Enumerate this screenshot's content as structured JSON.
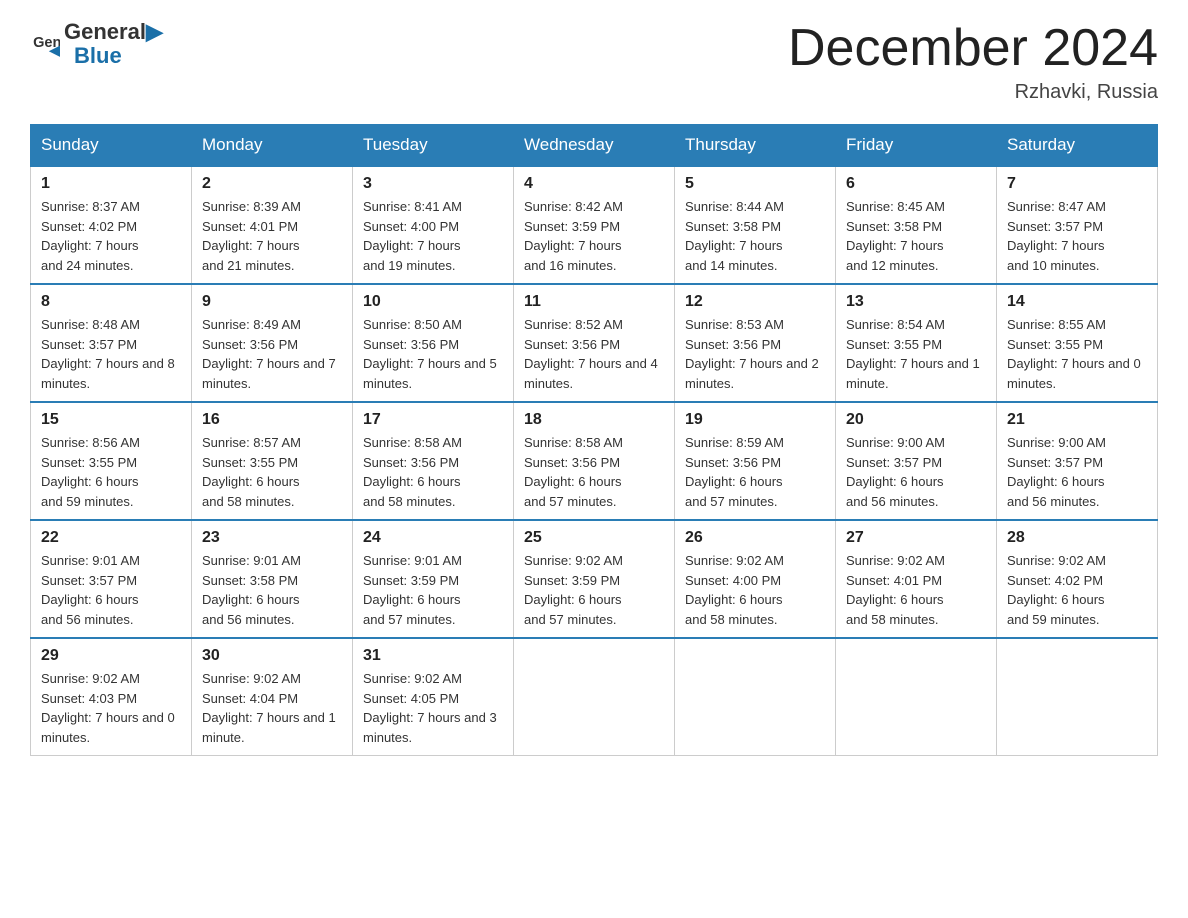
{
  "header": {
    "logo_general": "General",
    "logo_blue": "Blue",
    "month_title": "December 2024",
    "location": "Rzhavki, Russia"
  },
  "days_of_week": [
    "Sunday",
    "Monday",
    "Tuesday",
    "Wednesday",
    "Thursday",
    "Friday",
    "Saturday"
  ],
  "weeks": [
    [
      {
        "num": "1",
        "sunrise": "8:37 AM",
        "sunset": "4:02 PM",
        "daylight": "7 hours and 24 minutes."
      },
      {
        "num": "2",
        "sunrise": "8:39 AM",
        "sunset": "4:01 PM",
        "daylight": "7 hours and 21 minutes."
      },
      {
        "num": "3",
        "sunrise": "8:41 AM",
        "sunset": "4:00 PM",
        "daylight": "7 hours and 19 minutes."
      },
      {
        "num": "4",
        "sunrise": "8:42 AM",
        "sunset": "3:59 PM",
        "daylight": "7 hours and 16 minutes."
      },
      {
        "num": "5",
        "sunrise": "8:44 AM",
        "sunset": "3:58 PM",
        "daylight": "7 hours and 14 minutes."
      },
      {
        "num": "6",
        "sunrise": "8:45 AM",
        "sunset": "3:58 PM",
        "daylight": "7 hours and 12 minutes."
      },
      {
        "num": "7",
        "sunrise": "8:47 AM",
        "sunset": "3:57 PM",
        "daylight": "7 hours and 10 minutes."
      }
    ],
    [
      {
        "num": "8",
        "sunrise": "8:48 AM",
        "sunset": "3:57 PM",
        "daylight": "7 hours and 8 minutes."
      },
      {
        "num": "9",
        "sunrise": "8:49 AM",
        "sunset": "3:56 PM",
        "daylight": "7 hours and 7 minutes."
      },
      {
        "num": "10",
        "sunrise": "8:50 AM",
        "sunset": "3:56 PM",
        "daylight": "7 hours and 5 minutes."
      },
      {
        "num": "11",
        "sunrise": "8:52 AM",
        "sunset": "3:56 PM",
        "daylight": "7 hours and 4 minutes."
      },
      {
        "num": "12",
        "sunrise": "8:53 AM",
        "sunset": "3:56 PM",
        "daylight": "7 hours and 2 minutes."
      },
      {
        "num": "13",
        "sunrise": "8:54 AM",
        "sunset": "3:55 PM",
        "daylight": "7 hours and 1 minute."
      },
      {
        "num": "14",
        "sunrise": "8:55 AM",
        "sunset": "3:55 PM",
        "daylight": "7 hours and 0 minutes."
      }
    ],
    [
      {
        "num": "15",
        "sunrise": "8:56 AM",
        "sunset": "3:55 PM",
        "daylight": "6 hours and 59 minutes."
      },
      {
        "num": "16",
        "sunrise": "8:57 AM",
        "sunset": "3:55 PM",
        "daylight": "6 hours and 58 minutes."
      },
      {
        "num": "17",
        "sunrise": "8:58 AM",
        "sunset": "3:56 PM",
        "daylight": "6 hours and 58 minutes."
      },
      {
        "num": "18",
        "sunrise": "8:58 AM",
        "sunset": "3:56 PM",
        "daylight": "6 hours and 57 minutes."
      },
      {
        "num": "19",
        "sunrise": "8:59 AM",
        "sunset": "3:56 PM",
        "daylight": "6 hours and 57 minutes."
      },
      {
        "num": "20",
        "sunrise": "9:00 AM",
        "sunset": "3:57 PM",
        "daylight": "6 hours and 56 minutes."
      },
      {
        "num": "21",
        "sunrise": "9:00 AM",
        "sunset": "3:57 PM",
        "daylight": "6 hours and 56 minutes."
      }
    ],
    [
      {
        "num": "22",
        "sunrise": "9:01 AM",
        "sunset": "3:57 PM",
        "daylight": "6 hours and 56 minutes."
      },
      {
        "num": "23",
        "sunrise": "9:01 AM",
        "sunset": "3:58 PM",
        "daylight": "6 hours and 56 minutes."
      },
      {
        "num": "24",
        "sunrise": "9:01 AM",
        "sunset": "3:59 PM",
        "daylight": "6 hours and 57 minutes."
      },
      {
        "num": "25",
        "sunrise": "9:02 AM",
        "sunset": "3:59 PM",
        "daylight": "6 hours and 57 minutes."
      },
      {
        "num": "26",
        "sunrise": "9:02 AM",
        "sunset": "4:00 PM",
        "daylight": "6 hours and 58 minutes."
      },
      {
        "num": "27",
        "sunrise": "9:02 AM",
        "sunset": "4:01 PM",
        "daylight": "6 hours and 58 minutes."
      },
      {
        "num": "28",
        "sunrise": "9:02 AM",
        "sunset": "4:02 PM",
        "daylight": "6 hours and 59 minutes."
      }
    ],
    [
      {
        "num": "29",
        "sunrise": "9:02 AM",
        "sunset": "4:03 PM",
        "daylight": "7 hours and 0 minutes."
      },
      {
        "num": "30",
        "sunrise": "9:02 AM",
        "sunset": "4:04 PM",
        "daylight": "7 hours and 1 minute."
      },
      {
        "num": "31",
        "sunrise": "9:02 AM",
        "sunset": "4:05 PM",
        "daylight": "7 hours and 3 minutes."
      },
      null,
      null,
      null,
      null
    ]
  ]
}
